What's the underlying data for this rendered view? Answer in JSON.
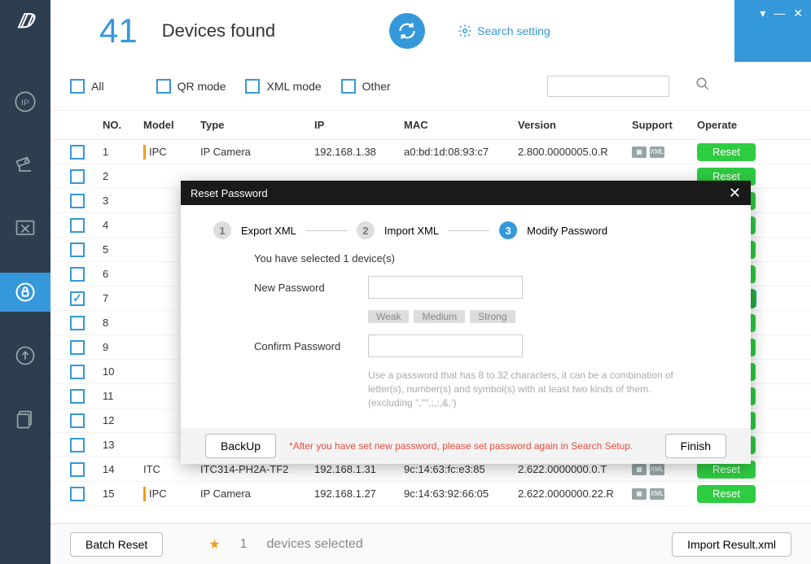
{
  "header": {
    "count": "41",
    "label": "Devices found",
    "search_setting": "Search setting"
  },
  "filters": {
    "all": "All",
    "qr": "QR mode",
    "xml": "XML mode",
    "other": "Other",
    "search_placeholder": ""
  },
  "columns": {
    "no": "NO.",
    "model": "Model",
    "type": "Type",
    "ip": "IP",
    "mac": "MAC",
    "version": "Version",
    "support": "Support",
    "operate": "Operate"
  },
  "rows": [
    {
      "no": "1",
      "model": "IPC",
      "type": "IP Camera",
      "ip": "192.168.1.38",
      "mac": "a0:bd:1d:08:93:c7",
      "version": "2.800.0000005.0.R",
      "bar": true,
      "checked": false
    },
    {
      "no": "2",
      "model": "",
      "type": "",
      "ip": "",
      "mac": "",
      "version": "",
      "checked": false
    },
    {
      "no": "3",
      "model": "",
      "type": "",
      "ip": "",
      "mac": "",
      "version": "",
      "checked": false
    },
    {
      "no": "4",
      "model": "",
      "type": "",
      "ip": "",
      "mac": "",
      "version": "",
      "checked": false
    },
    {
      "no": "5",
      "model": "",
      "type": "",
      "ip": "",
      "mac": "",
      "version": "",
      "checked": false
    },
    {
      "no": "6",
      "model": "",
      "type": "",
      "ip": "",
      "mac": "",
      "version": "",
      "checked": false
    },
    {
      "no": "7",
      "model": "",
      "type": "",
      "ip": "",
      "mac": "",
      "version": "",
      "checked": true,
      "highlight": true
    },
    {
      "no": "8",
      "model": "",
      "type": "",
      "ip": "",
      "mac": "",
      "version": "",
      "checked": false
    },
    {
      "no": "9",
      "model": "",
      "type": "",
      "ip": "",
      "mac": "",
      "version": "",
      "checked": false
    },
    {
      "no": "10",
      "model": "",
      "type": "",
      "ip": "",
      "mac": "",
      "version": "",
      "checked": false
    },
    {
      "no": "11",
      "model": "",
      "type": "",
      "ip": "",
      "mac": "",
      "version": "",
      "checked": false
    },
    {
      "no": "12",
      "model": "",
      "type": "",
      "ip": "",
      "mac": "",
      "version": "",
      "checked": false
    },
    {
      "no": "13",
      "model": "",
      "type": "",
      "ip": "",
      "mac": "",
      "version": "",
      "checked": false
    },
    {
      "no": "14",
      "model": "ITC",
      "type": "ITC314-PH2A-TF2",
      "ip": "192.168.1.31",
      "mac": "9c:14:63:fc:e3:85",
      "version": "2.622.0000000.0.T",
      "checked": false
    },
    {
      "no": "15",
      "model": "IPC",
      "type": "IP Camera",
      "ip": "192.168.1.27",
      "mac": "9c:14:63:92:66:05",
      "version": "2.622.0000000.22.R",
      "bar": true,
      "checked": false
    }
  ],
  "reset_label": "Reset",
  "footer": {
    "batch_reset": "Batch Reset",
    "selected_count": "1",
    "selected_label": "devices selected",
    "import_result": "Import Result.xml"
  },
  "modal": {
    "title": "Reset Password",
    "step1": "Export XML",
    "step2": "Import XML",
    "step3": "Modify Password",
    "selected_msg": "You have selected 1 device(s)",
    "new_pw_label": "New Password",
    "confirm_pw_label": "Confirm Password",
    "weak": "Weak",
    "medium": "Medium",
    "strong": "Strong",
    "hint": "Use a password that has 8 to 32 characters, it can be a combination of letter(s), number(s) and symbol(s) with at least two kinds of them.(excluding \",\"\",;,:,&,')",
    "backup": "BackUp",
    "warning": "*After you have set new password, please set password again in Search Setup.",
    "finish": "Finish"
  }
}
